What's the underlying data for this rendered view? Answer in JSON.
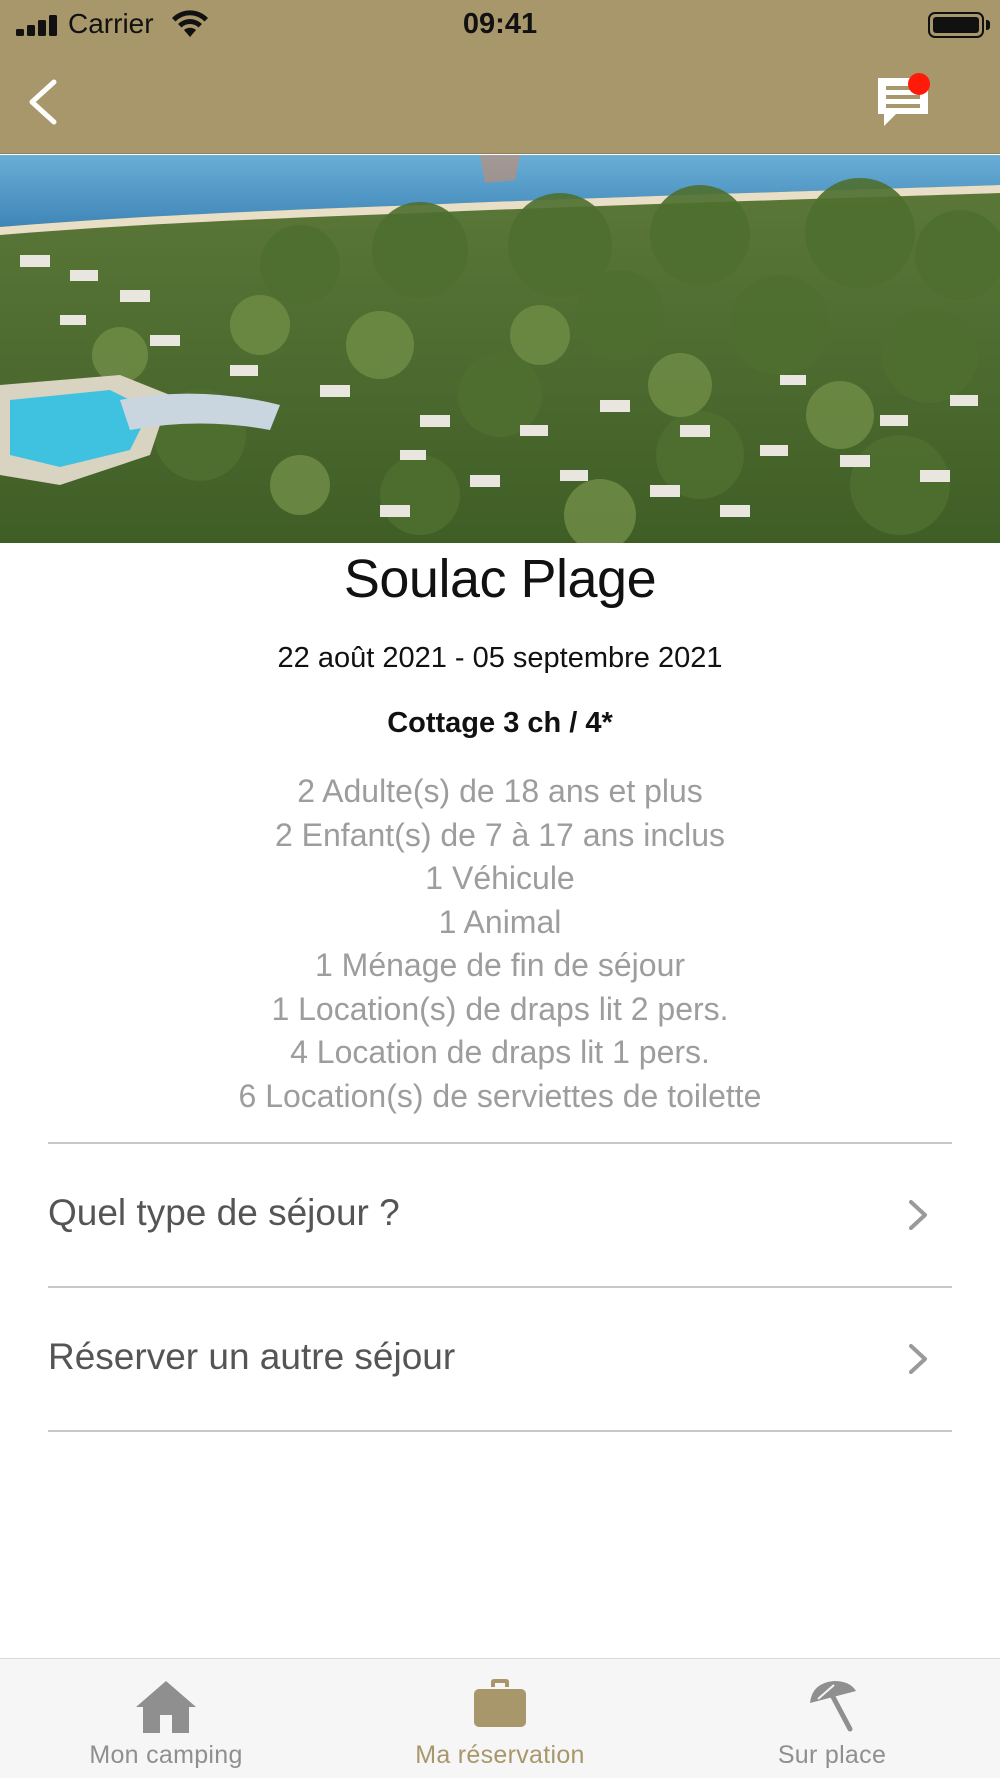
{
  "status_bar": {
    "carrier": "Carrier",
    "time": "09:41"
  },
  "nav": {
    "back_icon": "chevron-left-icon",
    "chat_icon": "chat-icon",
    "has_notification": true
  },
  "hero": {
    "description_icon": "campsite-aerial-photo"
  },
  "reservation": {
    "campsite": "Soulac Plage",
    "dates": "22 août 2021 - 05 septembre 2021",
    "accommodation": "Cottage 3 ch / 4*",
    "options": [
      "2 Adulte(s) de 18 ans et plus",
      "2 Enfant(s) de 7 à 17 ans inclus",
      "1 Véhicule",
      "1 Animal",
      "1 Ménage de fin de séjour",
      "1 Location(s) de draps lit 2 pers.",
      "4 Location de draps lit 1 pers.",
      "6 Location(s) de serviettes de toilette"
    ]
  },
  "links": [
    {
      "label": "Quel type de séjour ?"
    },
    {
      "label": "Réserver un autre séjour"
    }
  ],
  "tabs": [
    {
      "label": "Mon camping",
      "icon": "home-icon",
      "active": false
    },
    {
      "label": "Ma réservation",
      "icon": "briefcase-icon",
      "active": true
    },
    {
      "label": "Sur place",
      "icon": "beach-umbrella-icon",
      "active": false
    }
  ],
  "colors": {
    "header": "#a8976a",
    "accent": "#a8976a",
    "notification": "#ff1a0a",
    "muted_text": "#9d9d9d",
    "tab_inactive": "#8f8f8f"
  }
}
